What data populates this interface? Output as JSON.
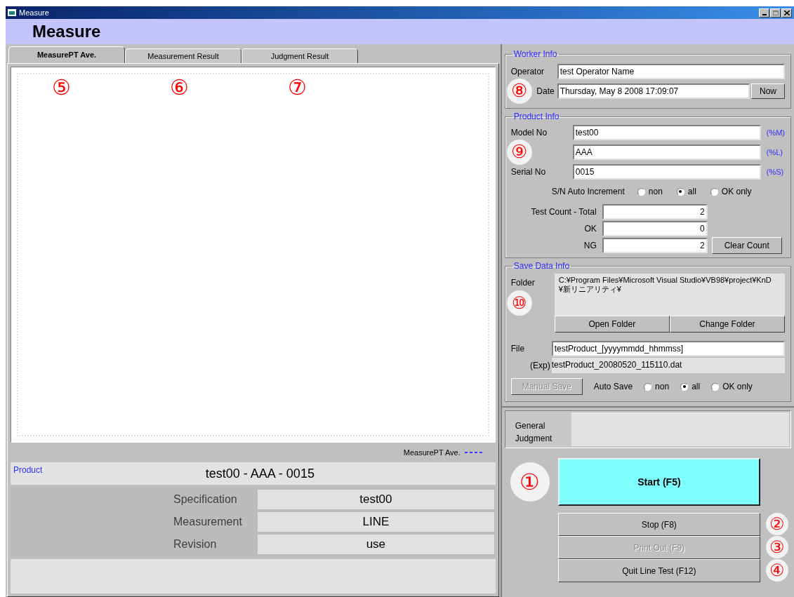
{
  "window": {
    "title": "Measure"
  },
  "header": {
    "title": "Measure"
  },
  "tabs": [
    {
      "label": "MeasurePT Ave.",
      "selected": true,
      "callout": "⑤"
    },
    {
      "label": "Measurement Result",
      "selected": false,
      "callout": "⑥"
    },
    {
      "label": "Judgment Result",
      "selected": false,
      "callout": "⑦"
    }
  ],
  "chart": {
    "legend": "MeasurePT Ave."
  },
  "product": {
    "label": "Product",
    "value": "test00 - AAA - 0015"
  },
  "spec_rows": [
    {
      "label": "Specification",
      "value": "test00"
    },
    {
      "label": "Measurement",
      "value": "LINE"
    },
    {
      "label": "Revision",
      "value": "use"
    }
  ],
  "worker_info": {
    "title": "Worker Info",
    "callout": "⑧",
    "operator": {
      "label": "Operator",
      "value": "test Operator Name"
    },
    "date": {
      "label": "Date",
      "value": "Thursday, May 8 2008  17:09:07"
    },
    "now_button": "Now"
  },
  "product_info": {
    "title": "Product Info",
    "callout": "⑨",
    "fields": [
      {
        "label": "Model No",
        "value": "test00",
        "code": "(%M)"
      },
      {
        "value": "AAA",
        "code": "(%L)"
      },
      {
        "label": "Serial No",
        "value": "0015",
        "code": "(%S)"
      }
    ],
    "sn_auto_increment": {
      "label": "S/N Auto Increment",
      "options": [
        {
          "label": "non",
          "selected": false
        },
        {
          "label": "all",
          "selected": true
        },
        {
          "label": "OK only",
          "selected": false
        }
      ]
    },
    "test_count": [
      {
        "label": "Test Count - Total",
        "value": "2"
      },
      {
        "label": "OK",
        "value": "0"
      },
      {
        "label": "NG",
        "value": "2"
      }
    ],
    "clear_button": "Clear Count"
  },
  "save_data_info": {
    "title": "Save Data Info",
    "callout": "⑩",
    "folder": {
      "label": "Folder",
      "value": "C:¥Program Files¥Microsoft Visual Studio¥VB98¥project¥KnD¥新リニアリティ¥"
    },
    "folder_buttons": [
      "Open Folder",
      "Change Folder"
    ],
    "file": {
      "label": "File",
      "value": "testProduct_[yyyymmdd_hhmmss]"
    },
    "example": {
      "label": "(Exp)",
      "value": "testProduct_20080520_115110.dat"
    },
    "manual_save": {
      "label": "Manual Save",
      "disabled": true
    },
    "auto_save": {
      "label": "Auto Save",
      "options": [
        {
          "label": "non",
          "selected": false
        },
        {
          "label": "all",
          "selected": true
        },
        {
          "label": "OK only",
          "selected": false
        }
      ]
    }
  },
  "general_judgment": {
    "label": "General Judgment"
  },
  "actions": [
    {
      "label": "Start (F5)",
      "kind": "primary",
      "disabled": false,
      "callout": "①"
    },
    {
      "label": "Stop (F8)",
      "kind": "normal",
      "disabled": false,
      "callout": "②"
    },
    {
      "label": "Print Out (F9)",
      "kind": "normal",
      "disabled": true,
      "callout": "③"
    },
    {
      "label": "Quit Line Test (F12)",
      "kind": "normal",
      "disabled": false,
      "callout": "④"
    }
  ]
}
